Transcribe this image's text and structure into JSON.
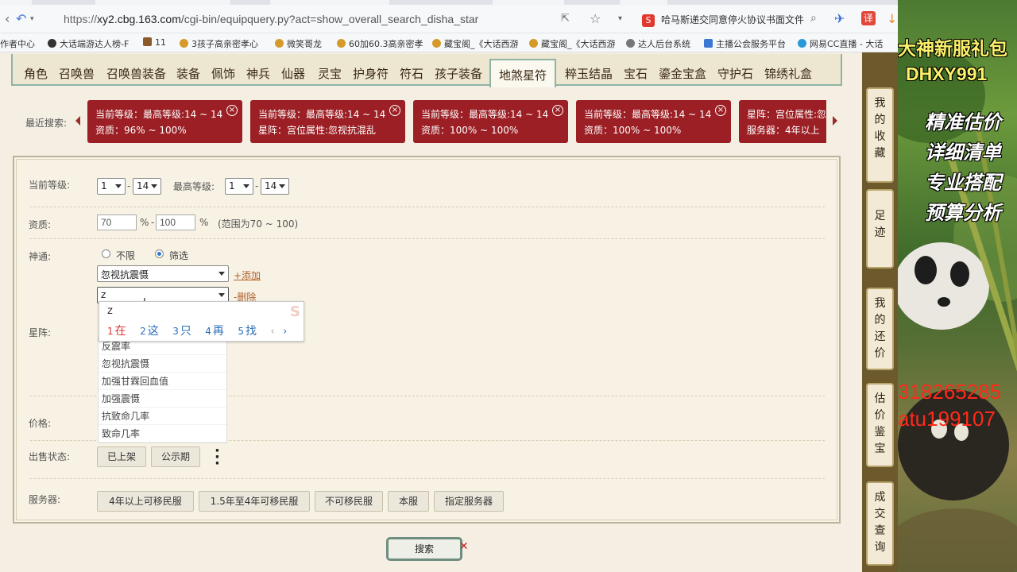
{
  "browser": {
    "url_prefix": "https://",
    "url_host": "xy2.cbg.163.com",
    "url_path": "/cgi-bin/equipquery.py?act=show_overall_search_disha_star",
    "notice": "哈马斯递交同意停火协议书面文件",
    "bookmarks": [
      "作者中心",
      "大话端游达人榜-F",
      "11",
      "3孩子高亲密孝心",
      "微笑哥龙",
      "60加60.3高亲密孝",
      "藏宝阁_《大话西游",
      "藏宝阁_《大话西游",
      "达人后台系统",
      "主播公会服务平台",
      "网易CC直播 - 大话"
    ]
  },
  "categories": [
    "角色",
    "召唤兽",
    "召唤兽装备",
    "装备",
    "佩饰",
    "神兵",
    "仙器",
    "灵宝",
    "护身符",
    "符石",
    "孩子装备",
    "地煞星符",
    "粹玉结晶",
    "宝石",
    "鎏金宝盒",
    "守护石",
    "锦绣礼盒"
  ],
  "recent": {
    "label": "最近搜索:",
    "chips": [
      {
        "line1": "当前等级：最高等级:14 ~ 14",
        "line2": "资质：96% ~ 100%"
      },
      {
        "line1": "当前等级：最高等级:14 ~ 14",
        "line2": "星阵：宫位属性:忽视抗混乱"
      },
      {
        "line1": "当前等级：最高等级:14 ~ 14",
        "line2": "资质：100% ~ 100%"
      },
      {
        "line1": "当前等级：最高等级:14 ~ 14",
        "line2": "资质：100% ~ 100%"
      },
      {
        "line1": "星阵：宫位属性:忽",
        "line2": "服务器：4年以上"
      }
    ]
  },
  "form": {
    "level_label": "当前等级:",
    "level_from": "1",
    "level_to": "14",
    "max_level_label": "最高等级:",
    "max_from": "1",
    "max_to": "14",
    "dash": "-",
    "quality_label": "资质:",
    "quality_min": "70",
    "quality_max": "100",
    "percent": "%",
    "quality_hint": "(范围为70 ~ 100)",
    "shentong_label": "神通:",
    "radio_unlimited": "不限",
    "radio_filter": "筛选",
    "select1_value": "忽视抗震慑",
    "add_link": "+添加",
    "select2_value": "z",
    "delete_link": "-删除",
    "xingzhen_label": "星阵:",
    "price_label": "价格:",
    "sale_label": "出售状态:",
    "sale_buttons": [
      "已上架",
      "公示期"
    ],
    "server_label": "服务器:",
    "server_buttons": [
      "4年以上可移民服",
      "1.5年至4年可移民服",
      "不可移民服",
      "本服",
      "指定服务器"
    ],
    "search_button": "搜索"
  },
  "dropdown_options": [
    "反震率",
    "忽视抗震慑",
    "加强甘霖回血值",
    "加强震慑",
    "抗致命几率",
    "致命几率"
  ],
  "ime": {
    "composition": "z",
    "candidates": [
      {
        "num": "1",
        "text": "在"
      },
      {
        "num": "2",
        "text": "这"
      },
      {
        "num": "3",
        "text": "只"
      },
      {
        "num": "4",
        "text": "再"
      },
      {
        "num": "5",
        "text": "找"
      }
    ]
  },
  "sidebar": [
    "我的收藏",
    "足迹",
    "我的还价",
    "估价鉴宝",
    "成交查询"
  ],
  "ad": {
    "title1": "大神新服礼包",
    "title2": "DHXY991",
    "lines": [
      "精准估价",
      "详细清单",
      "专业搭配",
      "预算分析"
    ],
    "contact1": "318265285",
    "contact2": "atu199107"
  }
}
